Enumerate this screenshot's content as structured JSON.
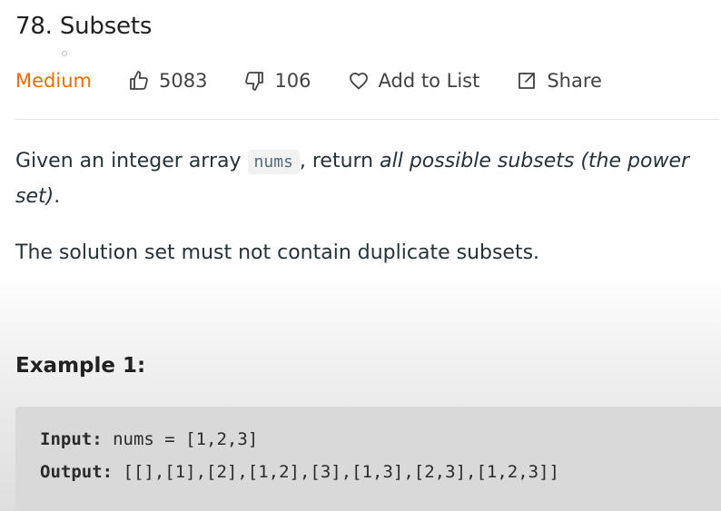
{
  "problem": {
    "title": "78. Subsets",
    "difficulty": "Medium",
    "likes": "5083",
    "dislikes": "106",
    "add_to_list_label": "Add to List",
    "share_label": "Share",
    "difficulty_color": "#ef6c00"
  },
  "description": {
    "p1_a": "Given an integer array ",
    "p1_code": "nums",
    "p1_b": ", return ",
    "p1_em": "all possible subsets (the power set)",
    "p1_c": ".",
    "p2": "The solution set must not contain duplicate subsets."
  },
  "example1": {
    "title": "Example 1:",
    "input_label": "Input:",
    "input_value": " nums = [1,2,3]",
    "output_label": "Output:",
    "output_value": " [[],[1],[2],[1,2],[3],[1,3],[2,3],[1,2,3]]"
  },
  "icons": {
    "like": "thumbs-up-icon",
    "dislike": "thumbs-down-icon",
    "add_to_list": "heart-icon",
    "share": "share-icon"
  }
}
